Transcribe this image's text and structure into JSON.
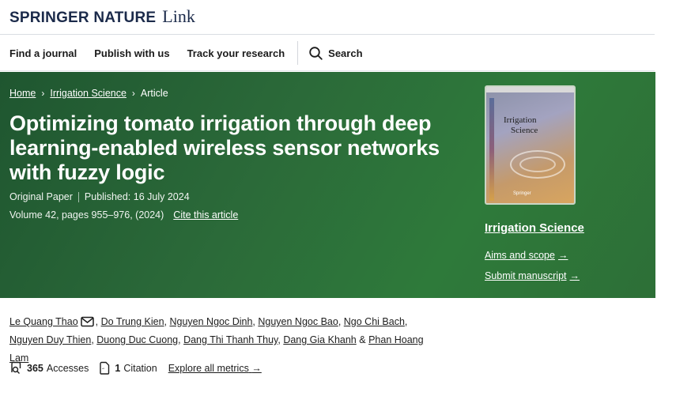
{
  "brand": {
    "name": "Springer Nature",
    "product": "Link"
  },
  "nav": {
    "items": [
      "Find a journal",
      "Publish with us",
      "Track your research"
    ],
    "search_label": "Search"
  },
  "breadcrumb": {
    "home": "Home",
    "journal": "Irrigation Science",
    "current": "Article"
  },
  "article": {
    "title": "Optimizing tomato irrigation through deep learning-enabled wireless sensor networks with fuzzy logic",
    "type": "Original Paper",
    "published": "Published: 16 July 2024",
    "volume": "Volume 42, pages 955–976, (2024)",
    "cite": "Cite this article"
  },
  "sidebar": {
    "cover_title_line1": "Irrigation",
    "cover_title_line2": "Science",
    "cover_publisher": "Springer",
    "journal_link": "Irrigation Science",
    "aims": "Aims and scope",
    "submit": "Submit manuscript"
  },
  "authors": [
    "Le Quang Thao",
    "Do Trung Kien",
    "Nguyen Ngoc Dinh",
    "Nguyen Ngoc Bao",
    "Ngo Chi Bach",
    "Nguyen Duy Thien",
    "Duong Duc Cuong",
    "Dang Thi Thanh Thuy",
    "Dang Gia Khanh",
    "Phan Hoang Lam"
  ],
  "author_and": "&",
  "metrics": {
    "accesses_count": "365",
    "accesses_label": "Accesses",
    "citation_count": "1",
    "citation_label": "Citation",
    "explore": "Explore all metrics"
  },
  "colors": {
    "hero_green": "#2b6a39",
    "brand_navy": "#1b2a4a"
  }
}
